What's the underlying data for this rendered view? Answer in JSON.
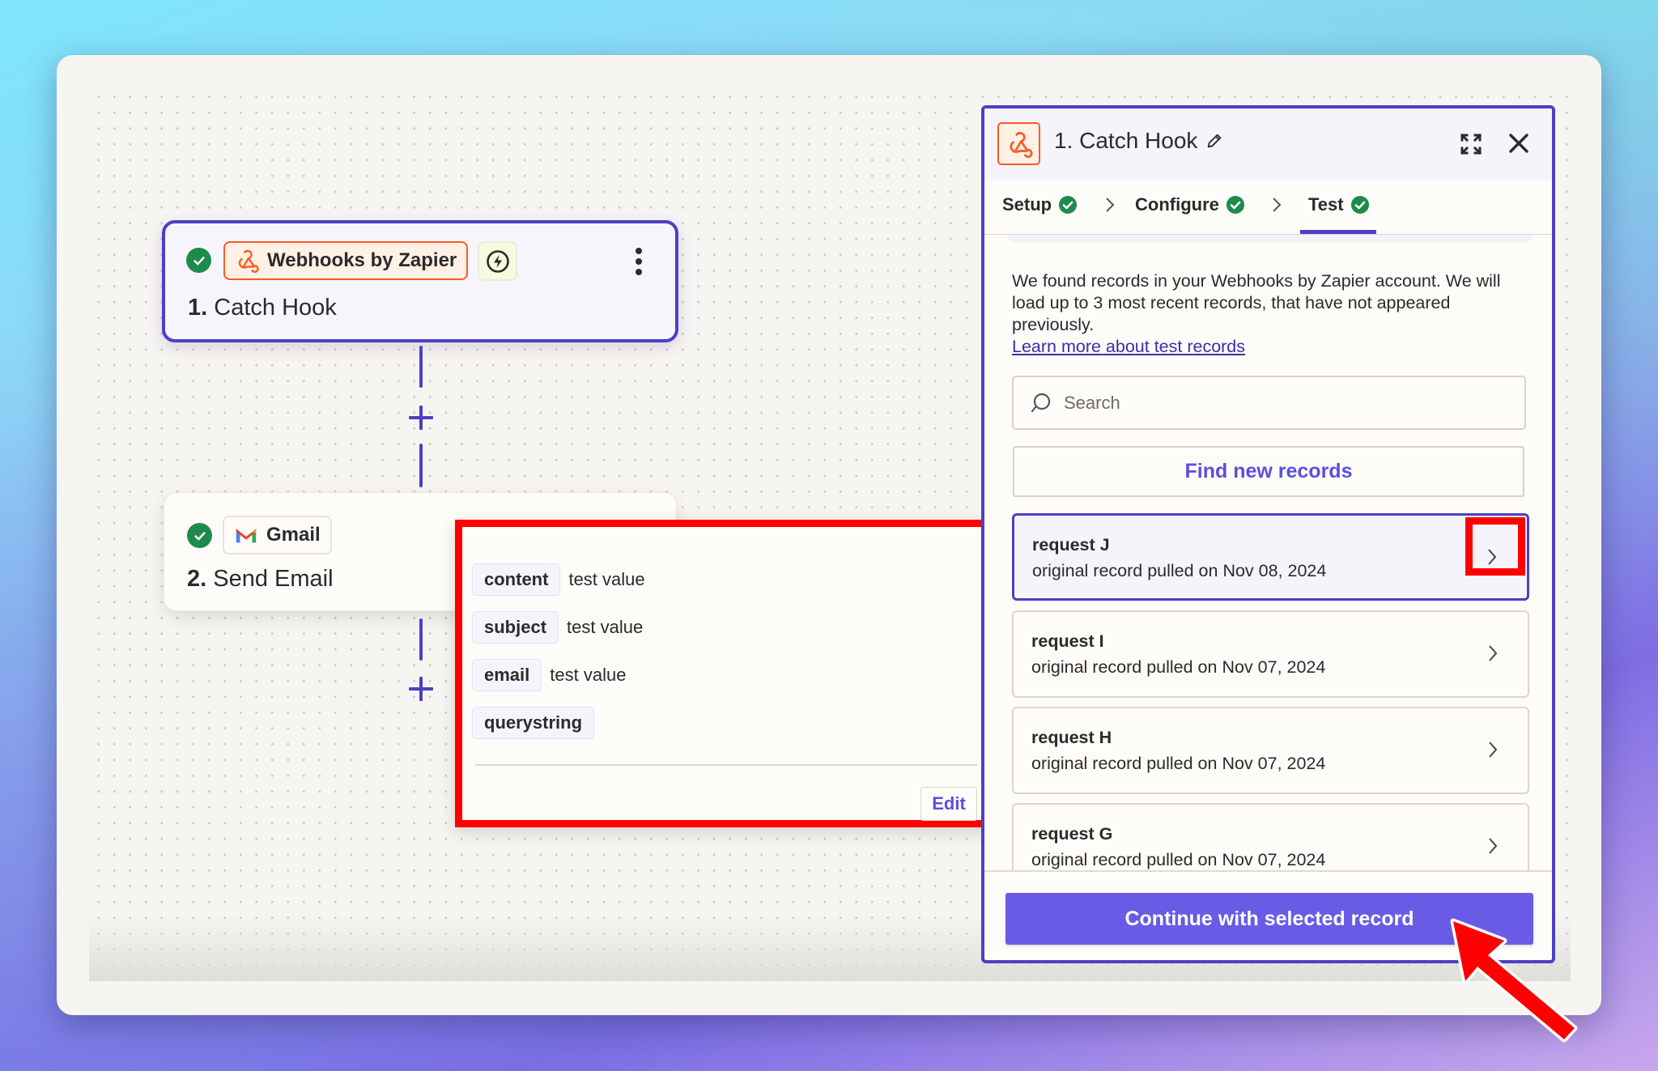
{
  "canvas": {
    "nodes": [
      {
        "status": "complete",
        "app_name": "Webhooks by Zapier",
        "app_icon": "webhook-icon",
        "trigger_badge_icon": "instant-bolt-icon",
        "step_number": "1.",
        "step_title": "Catch Hook",
        "menu_icon": "kebab-menu-icon"
      },
      {
        "status": "complete",
        "app_name": "Gmail",
        "app_icon": "gmail-icon",
        "step_number": "2.",
        "step_title": "Send Email",
        "menu_icon": "kebab-menu-icon"
      }
    ],
    "add_step_icon": "plus-icon"
  },
  "field_popup": {
    "fields": [
      {
        "key": "content",
        "value": "test value"
      },
      {
        "key": "subject",
        "value": "test value"
      },
      {
        "key": "email",
        "value": "test value"
      },
      {
        "key": "querystring",
        "value": ""
      }
    ],
    "edit_label": "Edit"
  },
  "panel": {
    "title": "1. Catch Hook",
    "app_icon": "webhook-icon",
    "edit_title_icon": "pencil-icon",
    "expand_icon": "expand-icon",
    "close_icon": "close-icon",
    "tabs": [
      {
        "label": "Setup",
        "complete": true
      },
      {
        "label": "Configure",
        "complete": true
      },
      {
        "label": "Test",
        "complete": true,
        "active": true
      }
    ],
    "description": "We found records in your Webhooks by Zapier account. We will load up to 3 most recent records, that have not appeared previously.",
    "learn_more_link": "Learn more about test records",
    "search": {
      "placeholder": "Search",
      "value": ""
    },
    "find_new_records_label": "Find new records",
    "records": [
      {
        "name": "request J",
        "subtitle": "original record pulled on Nov 08, 2024",
        "selected": true
      },
      {
        "name": "request I",
        "subtitle": "original record pulled on Nov 07, 2024",
        "selected": false
      },
      {
        "name": "request H",
        "subtitle": "original record pulled on Nov 07, 2024",
        "selected": false
      },
      {
        "name": "request G",
        "subtitle": "original record pulled on Nov 07, 2024",
        "selected": false
      }
    ],
    "continue_label": "Continue with selected record"
  },
  "colors": {
    "brand_purple": "#4d3fc4",
    "button_purple": "#695be6",
    "webhook_orange": "#ff5a1f",
    "success_green": "#1e8a4b",
    "annotation_red": "#ff0000"
  }
}
